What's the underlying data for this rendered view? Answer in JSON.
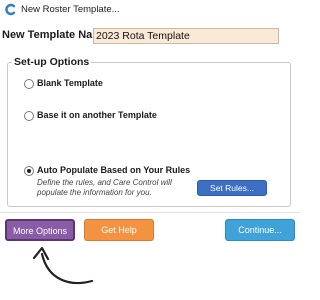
{
  "window": {
    "title": "New Roster Template...",
    "icon": "care-control-c-icon"
  },
  "template_name": {
    "label": "New Template Name",
    "value": "2023 Rota Template"
  },
  "setup": {
    "title": "Set-up Options",
    "options": [
      {
        "label": "Blank Template",
        "checked": false
      },
      {
        "label": "Base it on another Template",
        "checked": false
      },
      {
        "label": "Auto Populate Based on Your Rules",
        "checked": true
      }
    ],
    "description": "Define the rules, and Care Control will populate the information for you.",
    "set_rules_label": "Set Rules..."
  },
  "footer": {
    "more_options_label": "More Options",
    "get_help_label": "Get Help",
    "continue_label": "Continue..."
  },
  "colors": {
    "more_options": "#8a5ba6",
    "get_help": "#f39342",
    "continue": "#3fa2d9",
    "set_rules": "#3c6fc4",
    "input_bg": "#fbe9d8"
  }
}
